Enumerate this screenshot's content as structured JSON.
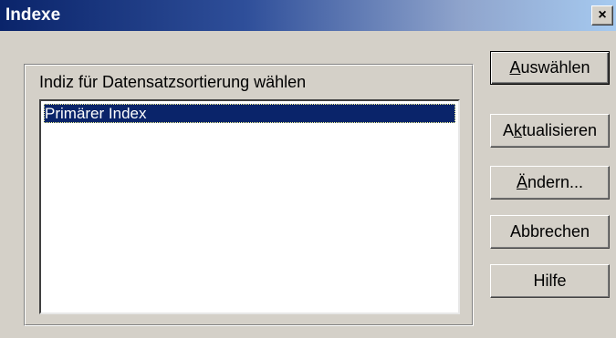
{
  "window": {
    "title": "Indexe",
    "close_glyph": "×"
  },
  "group": {
    "label": "Indiz für Datensatzsortierung wählen"
  },
  "list": {
    "items": [
      "Primärer Index"
    ],
    "selected_index": 0
  },
  "buttons": {
    "auswaehlen": {
      "pre": "",
      "mnemonic": "A",
      "post": "uswählen"
    },
    "aktualisieren": {
      "pre": "A",
      "mnemonic": "k",
      "post": "tualisieren"
    },
    "aendern": {
      "pre": "",
      "mnemonic": "Ä",
      "post": "ndern..."
    },
    "abbrechen": {
      "label": "Abbrechen"
    },
    "hilfe": {
      "label": "Hilfe"
    }
  },
  "colors": {
    "titlebar_start": "#0a246a",
    "titlebar_end": "#a6caf0",
    "face": "#d4d0c8",
    "selection": "#0a246a"
  }
}
